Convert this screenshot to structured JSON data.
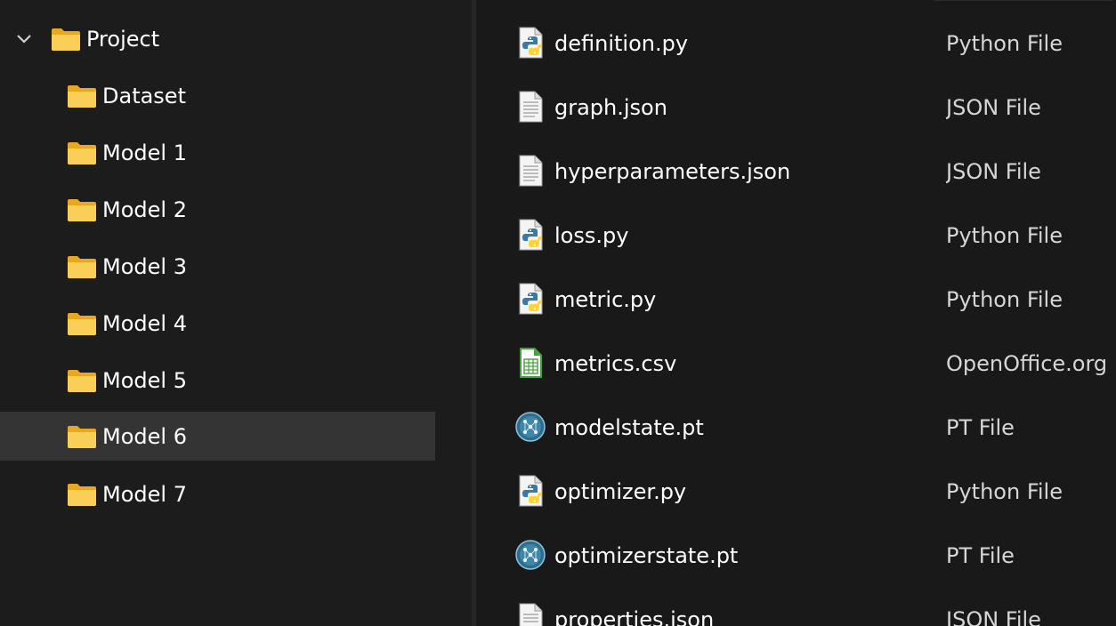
{
  "tree": {
    "root": {
      "label": "Project",
      "expanded": true,
      "icon": "folder-icon"
    },
    "children": [
      {
        "label": "Dataset",
        "icon": "folder-icon",
        "selected": false
      },
      {
        "label": "Model 1",
        "icon": "folder-icon",
        "selected": false
      },
      {
        "label": "Model 2",
        "icon": "folder-icon",
        "selected": false
      },
      {
        "label": "Model 3",
        "icon": "folder-icon",
        "selected": false
      },
      {
        "label": "Model 4",
        "icon": "folder-icon",
        "selected": false
      },
      {
        "label": "Model 5",
        "icon": "folder-icon",
        "selected": false
      },
      {
        "label": "Model 6",
        "icon": "folder-icon",
        "selected": true
      },
      {
        "label": "Model 7",
        "icon": "folder-icon",
        "selected": false
      }
    ]
  },
  "files": [
    {
      "name": "definition.py",
      "type": "Python File",
      "icon": "python-file-icon"
    },
    {
      "name": "graph.json",
      "type": "JSON File",
      "icon": "text-file-icon"
    },
    {
      "name": "hyperparameters.json",
      "type": "JSON File",
      "icon": "text-file-icon"
    },
    {
      "name": "loss.py",
      "type": "Python File",
      "icon": "python-file-icon"
    },
    {
      "name": "metric.py",
      "type": "Python File",
      "icon": "python-file-icon"
    },
    {
      "name": "metrics.csv",
      "type": "OpenOffice.org",
      "icon": "spreadsheet-file-icon"
    },
    {
      "name": "modelstate.pt",
      "type": "PT File",
      "icon": "pytorch-file-icon"
    },
    {
      "name": "optimizer.py",
      "type": "Python File",
      "icon": "python-file-icon"
    },
    {
      "name": "optimizerstate.pt",
      "type": "PT File",
      "icon": "pytorch-file-icon"
    },
    {
      "name": "properties.json",
      "type": "JSON File",
      "icon": "text-file-icon"
    }
  ],
  "colors": {
    "background": "#1c1c1c",
    "file_pane_background": "#191919",
    "selection": "#343434",
    "folder_yellow": "#f7c948",
    "spreadsheet_green": "#3fa535",
    "python_blue": "#3b77a8",
    "python_yellow": "#ffd43b"
  }
}
